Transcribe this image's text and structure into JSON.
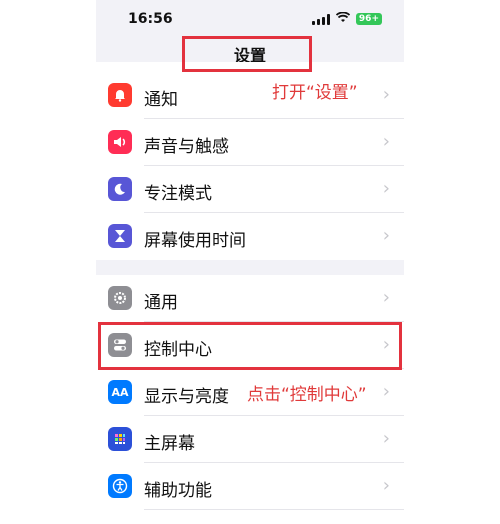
{
  "status_bar": {
    "time": "16:56",
    "battery": "96+"
  },
  "title": "设置",
  "group1": [
    {
      "label": "通知",
      "icon": "bell-icon",
      "color": "#ff3b30"
    },
    {
      "label": "声音与触感",
      "icon": "speaker-icon",
      "color": "#ff2d55"
    },
    {
      "label": "专注模式",
      "icon": "moon-icon",
      "color": "#5856d6"
    },
    {
      "label": "屏幕使用时间",
      "icon": "hourglass-icon",
      "color": "#5856d6"
    }
  ],
  "group2": [
    {
      "label": "通用",
      "icon": "gear-icon",
      "color": "#8e8e93"
    },
    {
      "label": "控制中心",
      "icon": "toggle-icon",
      "color": "#8e8e93"
    },
    {
      "label": "显示与亮度",
      "icon": "aa-icon",
      "color": "#007aff"
    },
    {
      "label": "主屏幕",
      "icon": "home-grid-icon",
      "color": "#2c50d8"
    },
    {
      "label": "辅助功能",
      "icon": "accessibility-icon",
      "color": "#007aff"
    }
  ],
  "annotations": {
    "open_settings": "打开“设置”",
    "tap_control_center": "点击“控制中心”"
  },
  "colors": {
    "annotation_red": "#e3323e"
  }
}
